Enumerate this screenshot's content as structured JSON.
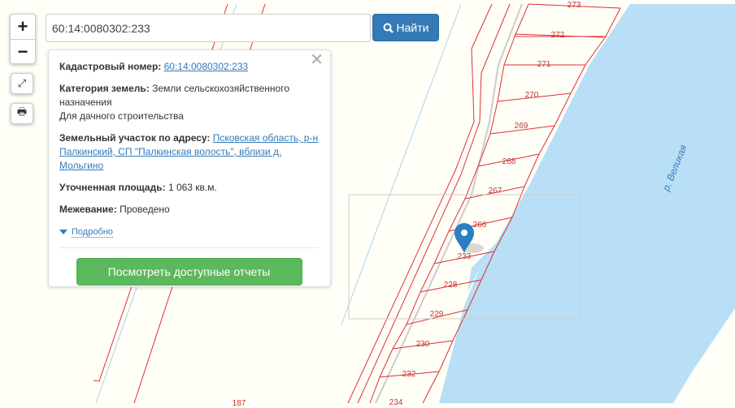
{
  "search": {
    "value": "60:14:0080302:233",
    "button": "Найти"
  },
  "controls": {
    "zoom_in": "+",
    "zoom_out": "−"
  },
  "popup": {
    "cadastral_label": "Кадастровый номер:",
    "cadastral_value": "60:14:0080302:233",
    "category_label": "Категория земель:",
    "category_value": "Земли сельскохозяйственного назначения",
    "use": "Для дачного строительства",
    "address_label": "Земельный участок по адресу:",
    "address_value": "Псковская область, р-н Палкинский, СП \"Палкинская волость\", вблизи д. Мольгино",
    "area_label": "Уточненная площадь:",
    "area_value": "1 063 кв.м.",
    "survey_label": "Межевание:",
    "survey_value": "Проведено",
    "more": "Подробно",
    "reports_button": "Посмотреть доступные отчеты"
  },
  "map": {
    "river_label": "р. Великая",
    "parcels": [
      "273",
      "272",
      "271",
      "270",
      "269",
      "268",
      "267",
      "266",
      "233",
      "228",
      "229",
      "230",
      "232",
      "234",
      "187"
    ],
    "colors": {
      "parcel": "#e03030",
      "water": "#b8dff5",
      "bg": "#fffef7",
      "marker": "#2a7fc4"
    }
  }
}
